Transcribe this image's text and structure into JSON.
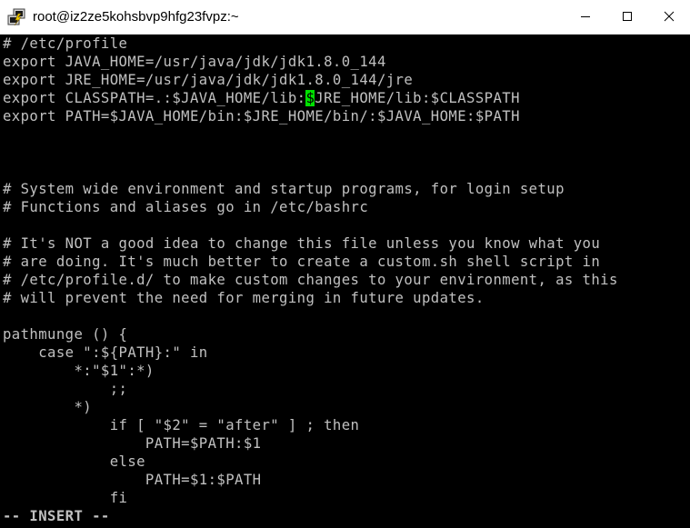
{
  "window": {
    "title": "root@iz2ze5kohsbvp9hfg23fvpz:~",
    "icon": "putty-icon",
    "buttons": [
      "minimize-icon",
      "maximize-icon",
      "close-icon"
    ]
  },
  "terminal": {
    "lines": [
      "# /etc/profile",
      "export JAVA_HOME=/usr/java/jdk/jdk1.8.0_144",
      "export JRE_HOME=/usr/java/jdk/jdk1.8.0_144/jre",
      "export CLASSPATH=.:$JAVA_HOME/lib:$JRE_HOME/lib:$CLASSPATH",
      "export PATH=$JAVA_HOME/bin:$JRE_HOME/bin/:$JAVA_HOME:$PATH",
      "",
      "",
      "",
      "# System wide environment and startup programs, for login setup",
      "# Functions and aliases go in /etc/bashrc",
      "",
      "# It's NOT a good idea to change this file unless you know what you",
      "# are doing. It's much better to create a custom.sh shell script in",
      "# /etc/profile.d/ to make custom changes to your environment, as this",
      "# will prevent the need for merging in future updates.",
      "",
      "pathmunge () {",
      "    case \":${PATH}:\" in",
      "        *:\"$1\":*)",
      "            ;;",
      "        *)",
      "            if [ \"$2\" = \"after\" ] ; then",
      "                PATH=$PATH:$1",
      "            else",
      "                PATH=$1:$PATH",
      "            fi"
    ],
    "cursor_line": {
      "before": "export CLASSPATH=.:$JAVA_HOME/lib:",
      "char": "$",
      "after": "JRE_HOME/lib:$CLASSPATH"
    },
    "status_line": "-- INSERT --"
  },
  "colors": {
    "background": "#000000",
    "foreground": "#c0c0c0",
    "cursor": "#00e000",
    "titlebar": "#ffffff"
  }
}
